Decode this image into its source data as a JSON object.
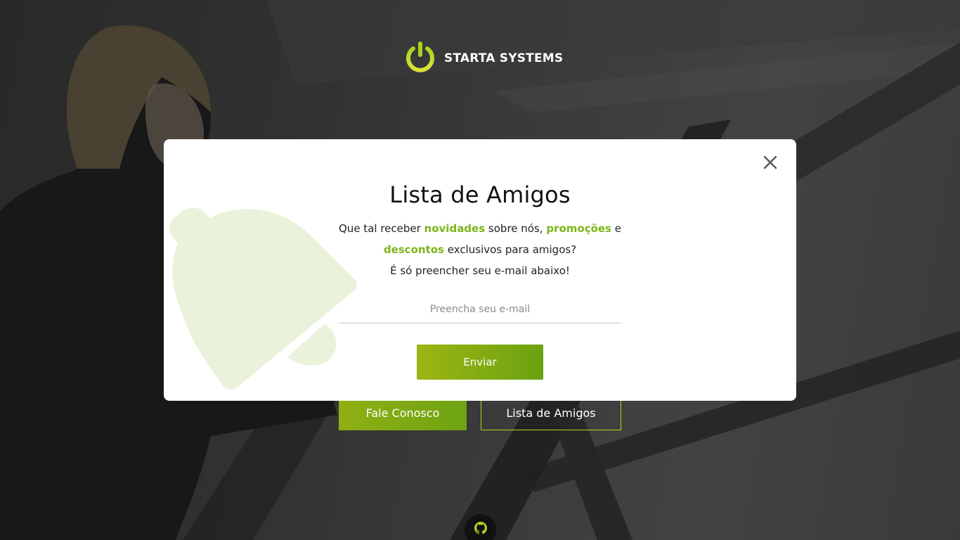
{
  "brand": {
    "name": "STARTA SYSTEMS",
    "logo_icon": "power-icon",
    "accent": "#7cb518"
  },
  "hero": {
    "contact_button": "Fale Conosco",
    "friends_button": "Lista de Amigos",
    "github_icon": "github-icon"
  },
  "modal": {
    "title": "Lista de Amigos",
    "text": {
      "p1": "Que tal receber ",
      "h1": "novidades",
      "p2": " sobre nós, ",
      "h2": "promoções",
      "p3": " e ",
      "h3": "descontos",
      "p4": " exclusivos para amigos?",
      "line3": "É só preencher seu e-mail abaixo!"
    },
    "email_placeholder": "Preencha seu e-mail",
    "email_value": "",
    "submit_label": "Enviar",
    "close_icon": "close-icon",
    "decoration_icon": "bell-icon"
  },
  "colors": {
    "accent_green": "#7cb518",
    "button_gradient_start": "#9db513",
    "button_gradient_end": "#6aa311",
    "outline_yellow": "#b7d21f",
    "bell_tint": "#eaf2dc"
  }
}
